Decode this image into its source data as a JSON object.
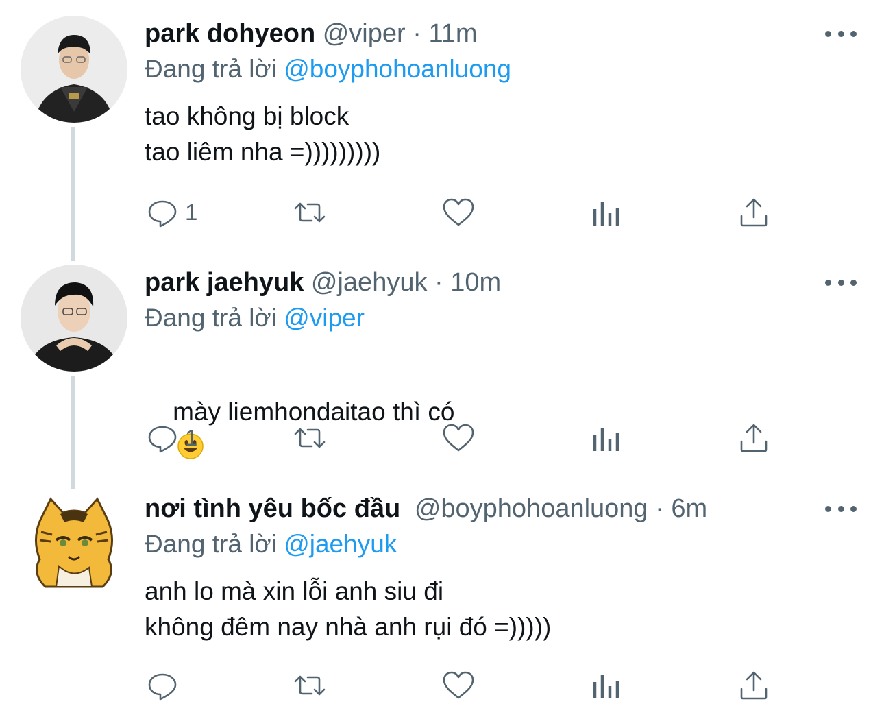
{
  "tweets": [
    {
      "name": "park dohyeon",
      "handle": "@viper",
      "separator": "·",
      "time": "11m",
      "reply_prefix": "Đang trả lời",
      "reply_to": "@boyphohoanluong",
      "text": "tao không bị block\ntao liêm nha =)))))))))",
      "reply_count": "1",
      "avatar_icon": "player-photo-avatar"
    },
    {
      "name": "park jaehyuk",
      "handle": "@jaehyuk",
      "separator": "·",
      "time": "10m",
      "reply_prefix": "Đang trả lời",
      "reply_to": "@viper",
      "text": "mày liemhondaitao thì có",
      "emoji": "smiley-emoji",
      "reply_count": "1",
      "avatar_icon": "player-photo-avatar"
    },
    {
      "name": "nơi tình yêu bốc đầu",
      "handle": "@boyphohoanluong",
      "separator": "·",
      "time": "6m",
      "reply_prefix": "Đang trả lời",
      "reply_to": "@jaehyuk",
      "text": "anh lo mà xin lỗi anh siu đi\nkhông đêm nay nhà anh rụi đó =)))))",
      "reply_count": "",
      "avatar_icon": "cartoon-cat-avatar"
    }
  ],
  "colors": {
    "link": "#1d9bf0",
    "secondary": "#536471",
    "thread_line": "#cfd9de"
  },
  "icons": [
    "reply-icon",
    "retweet-icon",
    "like-icon",
    "analytics-icon",
    "share-icon",
    "more-icon"
  ]
}
